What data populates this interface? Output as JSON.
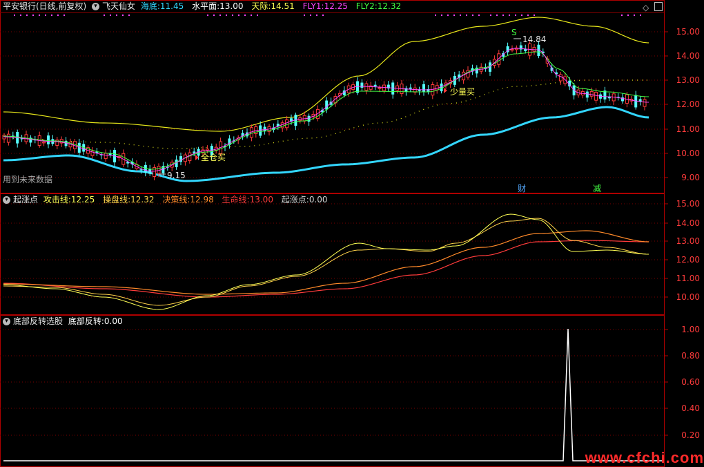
{
  "main": {
    "title": "平安银行(日线,前复权)",
    "indicator": "飞天仙女",
    "legend": [
      {
        "label": "海底:",
        "value": "11.45",
        "color": "#33d6ff"
      },
      {
        "label": "水平面:",
        "value": "13.00",
        "color": "#ffffff"
      },
      {
        "label": "天际:",
        "value": "14.51",
        "color": "#ffff55"
      },
      {
        "label": "FLY1:",
        "value": "12.25",
        "color": "#ff44ff"
      },
      {
        "label": "FLY2:",
        "value": "12.32",
        "color": "#44ff44"
      }
    ],
    "y_ticks": [
      "15.00",
      "14.00",
      "13.00",
      "12.00",
      "11.00",
      "10.00",
      "9.00"
    ],
    "future_label": "用到未来数据",
    "low_mark": "9.15",
    "high_mark": "14.84",
    "sell_mark": "S",
    "buy_all_label": "全仓买",
    "buy_small_label": "少量买",
    "finance_tag": "财",
    "reduce_tag": "减"
  },
  "pane2": {
    "name": "起涨点",
    "legend": [
      {
        "label": "攻击线:",
        "value": "12.25",
        "color": "#ffff55"
      },
      {
        "label": "操盘线:",
        "value": "12.32",
        "color": "#ffd24a"
      },
      {
        "label": "决策线:",
        "value": "12.98",
        "color": "#ff8a2a"
      },
      {
        "label": "生命线:",
        "value": "13.00",
        "color": "#ff3b3b"
      },
      {
        "label": "起涨点:",
        "value": "0.00",
        "color": "#d0d0d0"
      }
    ],
    "y_ticks": [
      "15.00",
      "14.00",
      "13.00",
      "12.00",
      "11.00",
      "10.00"
    ]
  },
  "pane3": {
    "name": "底部反转选股",
    "legend": [
      {
        "label": "底部反转:",
        "value": "0.00",
        "color": "#ffffff"
      }
    ],
    "y_ticks": [
      "1.00",
      "0.80",
      "0.60",
      "0.40",
      "0.20"
    ]
  },
  "watermark": "www.cfchi.com",
  "colors": {
    "up": "#ff3b3b",
    "down": "#55ffff",
    "frame": "#b00000"
  }
}
